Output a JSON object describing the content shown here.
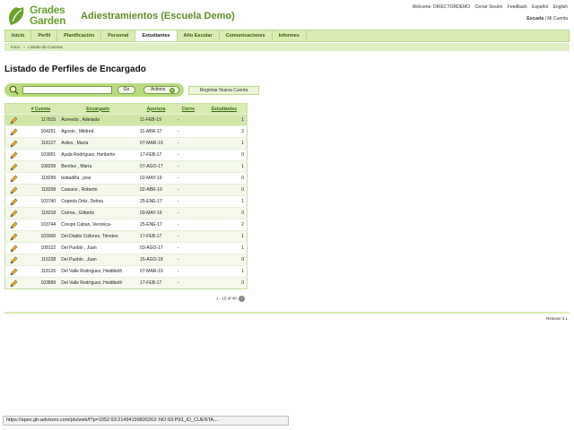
{
  "header": {
    "logo_line1": "Grades",
    "logo_line2": "Garden",
    "app_title": "Adiestramientos (Escuela Demo)",
    "welcome": "Welcome: DIRECTORDEMO",
    "logout": "Cerrar Sesión",
    "feedback": "Feedback",
    "lang_es": "Español",
    "lang_en": "English",
    "school_label": "Escuela",
    "account_link": "Mi Cuenta"
  },
  "tabs": [
    {
      "label": "Inicio"
    },
    {
      "label": "Perfil"
    },
    {
      "label": "Planificación"
    },
    {
      "label": "Personal"
    },
    {
      "label": "Estudiantes"
    },
    {
      "label": "Año Escolar"
    },
    {
      "label": "Comunicaciones"
    },
    {
      "label": "Informes"
    }
  ],
  "active_tab": "Estudiantes",
  "breadcrumb": {
    "home": "Inicio",
    "sep": ">",
    "current": "Listado de Cuentas"
  },
  "page_title": "Listado de Perfiles de Encargado",
  "search": {
    "value": "",
    "go_label": "Go",
    "actions_label": "Actions",
    "actions_caret": "▾"
  },
  "register_button": "Registrar Nueva Cuenta",
  "table": {
    "columns": {
      "account": "# Cuenta",
      "guardian": "Encargado",
      "opening": "Apertura",
      "closing": "Cierre",
      "students": "Estudiantes"
    },
    "rows": [
      {
        "account": "117815",
        "guardian": "Acevedo , Adelaida",
        "opening": "11-FEB-19",
        "closing": "-",
        "students": "1"
      },
      {
        "account": "104261",
        "guardian": "Agosto , Mildred",
        "opening": "11-ABR-17",
        "closing": "-",
        "students": "2"
      },
      {
        "account": "118127",
        "guardian": "Aviles , María",
        "opening": "07-MAR-19",
        "closing": "-",
        "students": "1"
      },
      {
        "account": "103901",
        "guardian": "Ayala Rodríguez, Heriberto",
        "opening": "17-FEB-17",
        "closing": "-",
        "students": "0"
      },
      {
        "account": "108209",
        "guardian": "Benítez , María",
        "opening": "07-AGO-17",
        "closing": "-",
        "students": "1"
      },
      {
        "account": "118299",
        "guardian": "bobadilla , jose",
        "opening": "02-MAY-19",
        "closing": "-",
        "students": "0"
      },
      {
        "account": "118208",
        "guardian": "Casiano , Roberto",
        "opening": "02-ABR-19",
        "closing": "-",
        "students": "0"
      },
      {
        "account": "103740",
        "guardian": "Cepeda Ortiz, Delma",
        "opening": "25-ENE-17",
        "closing": "-",
        "students": "1"
      },
      {
        "account": "118318",
        "guardian": "Correa , Gilberto",
        "opening": "09-MAY-19",
        "closing": "-",
        "students": "0"
      },
      {
        "account": "103744",
        "guardian": "Crespo Caban, Veronica-",
        "opening": "25-ENE-17",
        "closing": "-",
        "students": "2"
      },
      {
        "account": "103900",
        "guardian": "Del Diablo Collores, Timoteo",
        "opening": "17-FEB-17",
        "closing": "-",
        "students": "1"
      },
      {
        "account": "108122",
        "guardian": "Del Pueblo , Juan",
        "opening": "03-AGO-17",
        "closing": "-",
        "students": "1"
      },
      {
        "account": "115238",
        "guardian": "Del Pueblo , Juan",
        "opening": "15-AGO-18",
        "closing": "-",
        "students": "0"
      },
      {
        "account": "118126",
        "guardian": "Del Valle Rodríguez, Heidibeth",
        "opening": "07-MAR-19",
        "closing": "-",
        "students": "1"
      },
      {
        "account": "103899",
        "guardian": "Del Valle Rodríguez, Heidibeth",
        "opening": "17-FEB-17",
        "closing": "-",
        "students": "0"
      }
    ]
  },
  "pagination": {
    "text": "1 - 15 of 48",
    "next": "›"
  },
  "release": "Release 3.1",
  "status_url": "https://apex.gb-advisors.com/pls/web/f?p=1052:93:21494199835263::NO:93:P93_ID_CUENTA,...",
  "colors": {
    "brand": "#6aa22b",
    "tab_bg": "#d9ecb3",
    "row_highlight": "#cfe6a8"
  },
  "icons": {
    "search": "magnifier-icon",
    "edit": "pencil-icon",
    "next": "chevron-right-icon"
  }
}
